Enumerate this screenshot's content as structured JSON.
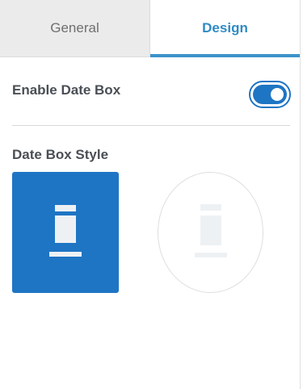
{
  "tabs": [
    {
      "label": "General",
      "active": false
    },
    {
      "label": "Design",
      "active": true
    }
  ],
  "enable_date_box": {
    "label": "Enable Date Box",
    "toggle_on": true
  },
  "date_box_style": {
    "label": "Date Box Style",
    "options": [
      {
        "name": "square",
        "selected": true
      },
      {
        "name": "circle",
        "selected": false
      }
    ]
  },
  "colors": {
    "accent": "#1e75c4",
    "tab_active_text": "#2f8bc4",
    "tab_inactive_bg": "#ebebeb"
  }
}
